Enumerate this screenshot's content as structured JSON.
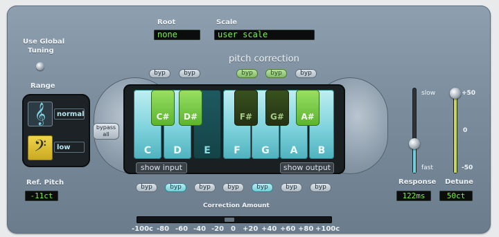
{
  "header": {
    "root_label": "Root",
    "root_value": "none",
    "scale_label": "Scale",
    "scale_value": "user scale",
    "pitch_correction_label": "pitch correction"
  },
  "left": {
    "global_tuning_label_1": "Use Global",
    "global_tuning_label_2": "Tuning",
    "range_label": "Range",
    "range_normal": "normal",
    "range_low": "low",
    "ref_pitch_label": "Ref. Pitch",
    "ref_pitch_value": "-11ct"
  },
  "keyboard": {
    "white_keys": [
      "C",
      "D",
      "E",
      "F",
      "G",
      "A",
      "B"
    ],
    "black_keys": [
      "C#",
      "D#",
      "F#",
      "G#",
      "A#"
    ],
    "show_input": "show input",
    "show_output": "show output",
    "bypass_all_1": "bypass",
    "bypass_all_2": "all",
    "byp": "byp"
  },
  "right": {
    "slow_label": "slow",
    "fast_label": "fast",
    "response_label": "Response",
    "response_value": "122ms",
    "detune_label": "Detune",
    "detune_value": "50ct",
    "detune_ticks": [
      "+50",
      "0",
      "-50"
    ]
  },
  "amount": {
    "label": "Correction Amount",
    "scale": [
      "-100c",
      "-80",
      "-60",
      "-40",
      "-20",
      "0",
      "+20",
      "+40",
      "+60",
      "+80",
      "+100c"
    ]
  },
  "colors": {
    "lcd_text": "#7cf04a",
    "key_cyan": "#7fd3dc",
    "key_green": "#6cbf3a",
    "bass_yellow": "#e6c93a"
  }
}
